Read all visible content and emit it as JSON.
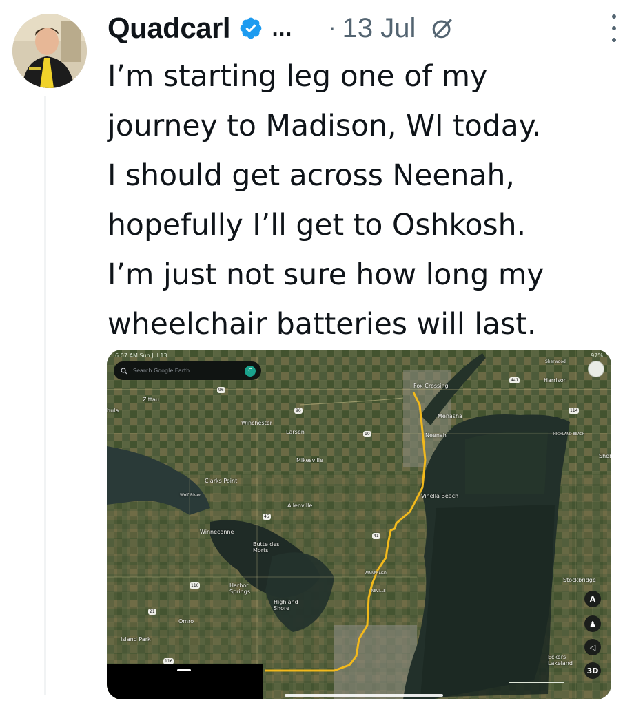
{
  "tweet": {
    "author_name": "Quadcarl",
    "ellipsis": "...",
    "separator": "·",
    "date": "13 Jul",
    "text": "I’m starting leg one of my\njourney to Madison, WI today.\nI should get across Neenah,\nhopefully I’ll get to Oshkosh.\nI’m just not sure how long my\nwheelchair batteries will last."
  },
  "icons": {
    "verified": "verified-badge-icon",
    "grok": "grok-icon",
    "more": "more-options-icon"
  },
  "colors": {
    "verified_blue": "#1d9bf0",
    "route_yellow": "#f2b91c",
    "text": "#0f1419",
    "muted": "#536471"
  },
  "map": {
    "status_time": "6:07 AM  Sun Jul 13",
    "status_battery": "97%",
    "search_placeholder": "Search Google Earth",
    "account_initial": "C",
    "control_labels": {
      "north": "A",
      "pegman": "♟",
      "locate": "◁",
      "three_d": "3D"
    },
    "places": {
      "zittau": "Zittau",
      "winchester": "Winchester",
      "larsen": "Larsen",
      "fox_crossing": "Fox Crossing",
      "menasha": "Menasha",
      "neenah": "Neenah",
      "harrison": "Harrison",
      "sherwood": "Sherwood",
      "highland_beach": "HIGHLAND BEACH",
      "sheb": "Sheb",
      "mikesville": "Mikesville",
      "clarks_point": "Clarks Point",
      "wolf_river": "Wolf River",
      "allenville": "Allenville",
      "vinella_beach": "Vinella Beach",
      "winneconne": "Winneconne",
      "butte_des_morts": "Butte des Morts",
      "harbor_springs": "Harbor Springs",
      "highland_shore": "Highland Shore",
      "omro": "Omro",
      "island_park": "Island Park",
      "stockbridge": "Stockbridge",
      "eckers_lakeland": "Eckers Lakeland",
      "winnebago": "WINNEBAGO",
      "neville": "NEVILLE",
      "left_edge": "hula"
    }
  }
}
